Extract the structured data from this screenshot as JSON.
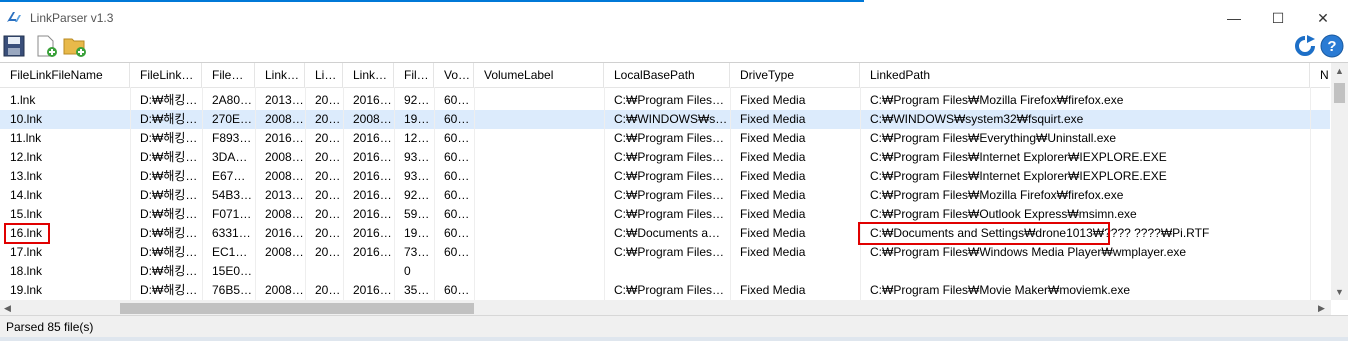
{
  "window": {
    "title": "LinkParser v1.3"
  },
  "title_buttons": {
    "minimize": "—",
    "maximize": "☐",
    "close": "✕"
  },
  "toolbar": {
    "icons": [
      "save-icon",
      "new-file-icon",
      "open-folder-icon",
      "refresh-icon",
      "help-icon"
    ],
    "help_glyph": "?"
  },
  "columns": [
    "FileLinkFileName",
    "FileLink…",
    "File…",
    "Link…",
    "Li…",
    "Link…",
    "Fil…",
    "Vo…",
    "VolumeLabel",
    "LocalBasePath",
    "DriveType",
    "LinkedPath",
    "N"
  ],
  "rows": [
    [
      "1.lnk",
      "D:₩해킹…",
      "2A80…",
      "2013…",
      "20…",
      "2016…",
      "92…",
      "60…",
      "",
      "C:₩Program Files…",
      "Fixed Media",
      "C:₩Program Files₩Mozilla Firefox₩firefox.exe"
    ],
    [
      "10.lnk",
      "D:₩해킹…",
      "270E…",
      "2008…",
      "20…",
      "2008…",
      "19…",
      "60…",
      "",
      "C:₩WINDOWS₩s…",
      "Fixed Media",
      "C:₩WINDOWS₩system32₩fsquirt.exe"
    ],
    [
      "11.lnk",
      "D:₩해킹…",
      "F893…",
      "2016…",
      "20…",
      "2016…",
      "12…",
      "60…",
      "",
      "C:₩Program Files…",
      "Fixed Media",
      "C:₩Program Files₩Everything₩Uninstall.exe"
    ],
    [
      "12.lnk",
      "D:₩해킹…",
      "3DA…",
      "2008…",
      "20…",
      "2016…",
      "93…",
      "60…",
      "",
      "C:₩Program Files…",
      "Fixed Media",
      "C:₩Program Files₩Internet Explorer₩IEXPLORE.EXE"
    ],
    [
      "13.lnk",
      "D:₩해킹…",
      "E67…",
      "2008…",
      "20…",
      "2016…",
      "93…",
      "60…",
      "",
      "C:₩Program Files…",
      "Fixed Media",
      "C:₩Program Files₩Internet Explorer₩IEXPLORE.EXE"
    ],
    [
      "14.lnk",
      "D:₩해킹…",
      "54B3…",
      "2013…",
      "20…",
      "2016…",
      "92…",
      "60…",
      "",
      "C:₩Program Files…",
      "Fixed Media",
      "C:₩Program Files₩Mozilla Firefox₩firefox.exe"
    ],
    [
      "15.lnk",
      "D:₩해킹…",
      "F071…",
      "2008…",
      "20…",
      "2016…",
      "59…",
      "60…",
      "",
      "C:₩Program Files…",
      "Fixed Media",
      "C:₩Program Files₩Outlook Express₩msimn.exe"
    ],
    [
      "16.lnk",
      "D:₩해킹…",
      "6331…",
      "2016…",
      "20…",
      "2016…",
      "19…",
      "60…",
      "",
      "C:₩Documents a…",
      "Fixed Media",
      "C:₩Documents and Settings₩drone1013₩???? ????₩Pi.RTF"
    ],
    [
      "17.lnk",
      "D:₩해킹…",
      "EC1…",
      "2008…",
      "20…",
      "2016…",
      "73…",
      "60…",
      "",
      "C:₩Program Files…",
      "Fixed Media",
      "C:₩Program Files₩Windows Media Player₩wmplayer.exe"
    ],
    [
      "18.lnk",
      "D:₩해킹…",
      "15E0…",
      "",
      "",
      "",
      "0",
      "",
      "",
      "",
      "",
      ""
    ],
    [
      "19.lnk",
      "D:₩해킹…",
      "76B5…",
      "2008…",
      "20…",
      "2016…",
      "35…",
      "60…",
      "",
      "C:₩Program Files…",
      "Fixed Media",
      "C:₩Program Files₩Movie Maker₩moviemk.exe"
    ]
  ],
  "selected_row": 1,
  "highlighted_row": 7,
  "status": {
    "text": "Parsed 85 file(s)"
  },
  "colors": {
    "selection": "#dcebfc",
    "highlight_box": "#e00000",
    "accent": "#0078d7"
  }
}
